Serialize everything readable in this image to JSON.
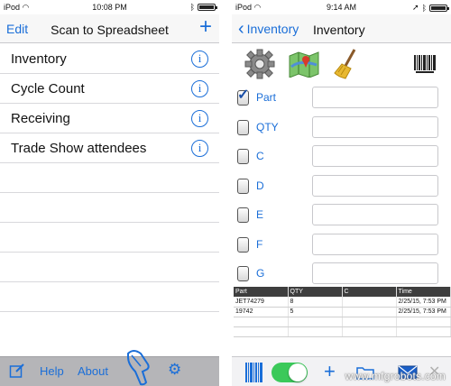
{
  "left": {
    "status": {
      "carrier": "iPod",
      "time": "10:08 PM"
    },
    "nav": {
      "edit": "Edit",
      "title": "Scan to Spreadsheet",
      "plus": "+"
    },
    "rows": [
      {
        "label": "Inventory"
      },
      {
        "label": "Cycle Count"
      },
      {
        "label": "Receiving"
      },
      {
        "label": "Trade Show attendees"
      }
    ],
    "toolbar": {
      "help": "Help",
      "about": "About"
    },
    "battery_level": 0.9
  },
  "right": {
    "status": {
      "carrier": "iPod",
      "time": "9:14 AM"
    },
    "nav": {
      "back": "Inventory",
      "title": "Inventory"
    },
    "fields": [
      {
        "label": "Part",
        "checked": true
      },
      {
        "label": "QTY",
        "checked": false
      },
      {
        "label": "C",
        "checked": false
      },
      {
        "label": "D",
        "checked": false
      },
      {
        "label": "E",
        "checked": false
      },
      {
        "label": "F",
        "checked": false
      },
      {
        "label": "G",
        "checked": false
      }
    ],
    "table": {
      "headers": [
        "Part",
        "QTY",
        "C",
        "Time"
      ],
      "rows": [
        [
          "JET74279",
          "8",
          "",
          "2/25/15, 7:53 PM"
        ],
        [
          "19742",
          "5",
          "",
          "2/25/15, 7:53 PM"
        ]
      ]
    },
    "toggle_on": true,
    "battery_level": 0.9
  },
  "watermark": "www.mfgrobots.com",
  "colors": {
    "accent": "#1a6ed8",
    "toggle": "#3bc95a"
  }
}
